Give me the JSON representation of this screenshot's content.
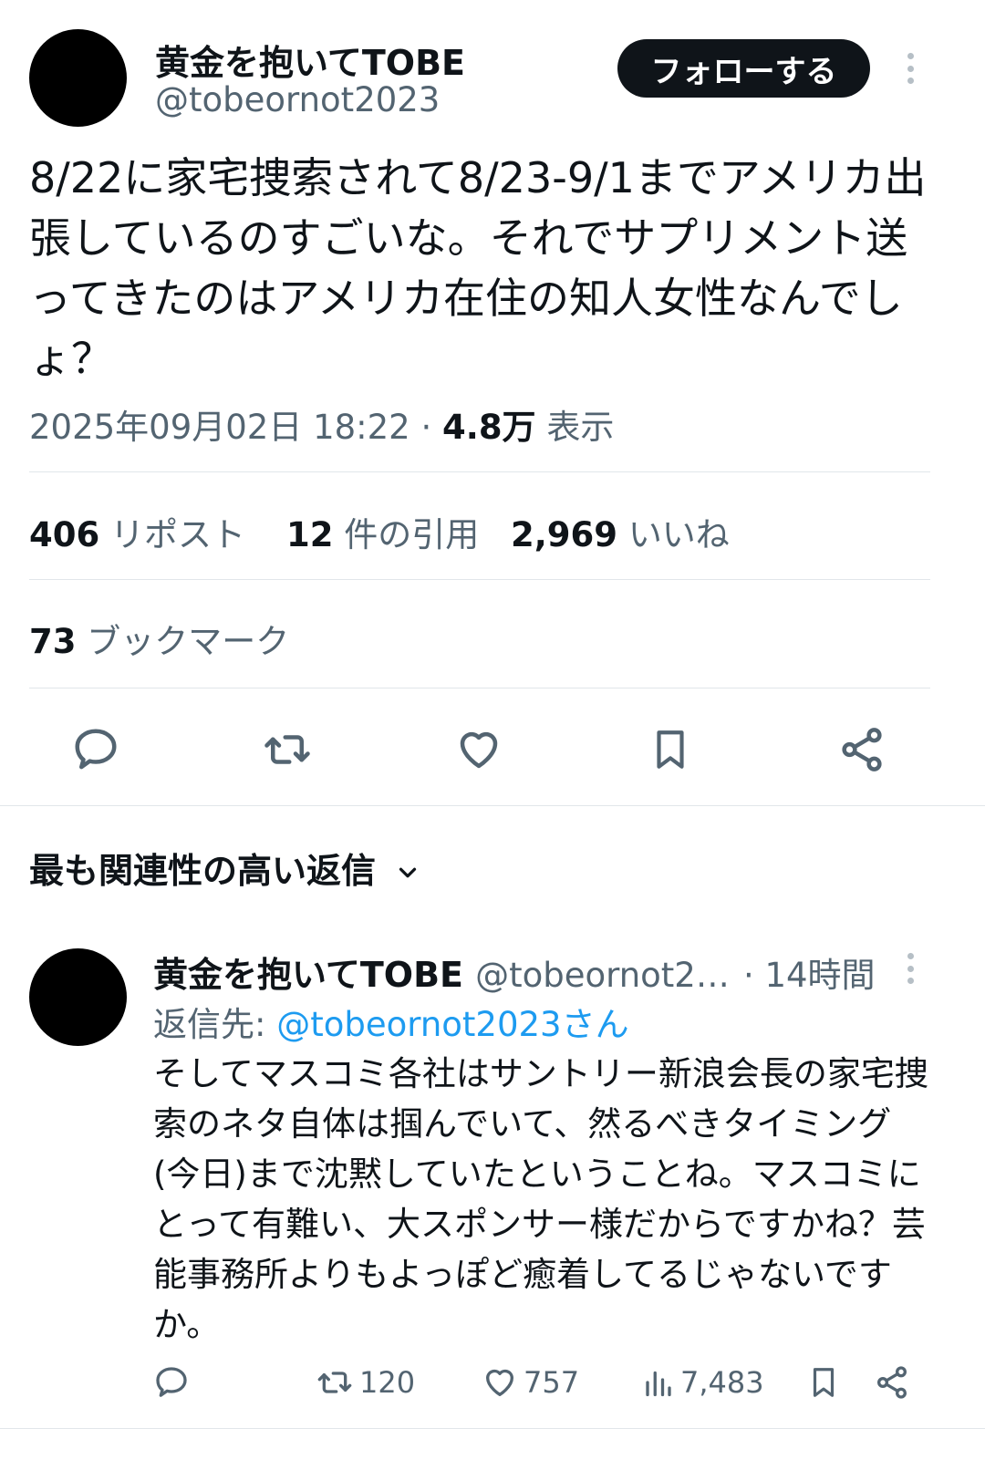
{
  "tweet": {
    "author_name": "黄金を抱いてTOBE",
    "author_handle": "@tobeornot2023",
    "follow_label": "フォローする",
    "text": "8/22に家宅捜索されて8/23-9/1までアメリカ出張しているのすごいな。それでサプリメント送ってきたのはアメリカ在住の知人女性なんでしょ？",
    "timestamp": "2025年09月02日 18:22",
    "separator": "·",
    "views_count": "4.8万",
    "views_label": "表示",
    "reposts_count": "406",
    "reposts_label": "リポスト",
    "quotes_count": "12",
    "quotes_label": "件の引用",
    "likes_count": "2,969",
    "likes_label": "いいね",
    "bookmarks_count": "73",
    "bookmarks_label": "ブックマーク"
  },
  "replies_section": {
    "title": "最も関連性の高い返信"
  },
  "reply": {
    "author_name": "黄金を抱いてTOBE",
    "author_handle": "@tobeornot2…",
    "time": "· 14時間",
    "reply_to_label": "返信先:",
    "reply_to_handle": "@tobeornot2023さん",
    "text": "そしてマスコミ各社はサントリー新浪会長の家宅捜索のネタ自体は掴んでいて、然るべきタイミング(今日)まで沈黙していたということね。マスコミにとって有難い、大スポンサー様だからですかね？芸能事務所よりもよっぽど癒着してるじゃないですか。",
    "retweets": "120",
    "likes": "757",
    "views": "7,483"
  },
  "colors": {
    "accent": "#1d9bf0",
    "text": "#0f1419",
    "muted": "#536471"
  }
}
